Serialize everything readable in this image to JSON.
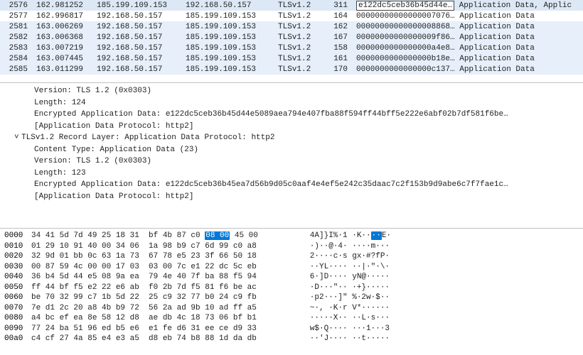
{
  "packets": [
    {
      "no": "2576",
      "time": "162.981252",
      "src": "185.199.109.153",
      "dst": "192.168.50.157",
      "proto": "TLSv1.2",
      "len": "311",
      "info_prefix": "e122dc5ceb36b45d44e…",
      "info_rest": " Application Data, Applic",
      "hl": true,
      "rowclass": "row-sel"
    },
    {
      "no": "2577",
      "time": "162.996817",
      "src": "192.168.50.157",
      "dst": "185.199.109.153",
      "proto": "TLSv1.2",
      "len": "164",
      "info": "00000000000000007076… Application Data",
      "rowclass": "row-plain"
    },
    {
      "no": "2581",
      "time": "163.006269",
      "src": "192.168.50.157",
      "dst": "185.199.109.153",
      "proto": "TLSv1.2",
      "len": "162",
      "info": "00000000000000008868… Application Data",
      "rowclass": "row-sel2"
    },
    {
      "no": "2582",
      "time": "163.006368",
      "src": "192.168.50.157",
      "dst": "185.199.109.153",
      "proto": "TLSv1.2",
      "len": "167",
      "info": "00000000000000009f86… Application Data",
      "rowclass": "row-sel2"
    },
    {
      "no": "2583",
      "time": "163.007219",
      "src": "192.168.50.157",
      "dst": "185.199.109.153",
      "proto": "TLSv1.2",
      "len": "158",
      "info": "0000000000000000a4e8… Application Data",
      "rowclass": "row-sel2"
    },
    {
      "no": "2584",
      "time": "163.007445",
      "src": "192.168.50.157",
      "dst": "185.199.109.153",
      "proto": "TLSv1.2",
      "len": "161",
      "info": "0000000000000000b18e… Application Data",
      "rowclass": "row-sel2"
    },
    {
      "no": "2585",
      "time": "163.011299",
      "src": "192.168.50.157",
      "dst": "185.199.109.153",
      "proto": "TLSv1.2",
      "len": "170",
      "info": "0000000000000000c137… Application Data",
      "rowclass": "row-sel2"
    }
  ],
  "details": {
    "version": "Version: TLS 1.2 (0x0303)",
    "length1": "Length: 124",
    "enc1": "Encrypted Application Data: e122dc5ceb36b45d44e5089aea794e407fba88f594ff44bff5e222e6abf02b7df581f6be…",
    "adp1": "[Application Data Protocol: http2]",
    "record": "TLSv1.2 Record Layer: Application Data Protocol: http2",
    "contenttype": "Content Type: Application Data (23)",
    "version2": "Version: TLS 1.2 (0x0303)",
    "length2": "Length: 123",
    "enc2": "Encrypted Application Data: e122dc5ceb36b45ea7d56b9d05c0aaf4e4ef5e242c35daac7c2f153b9d9abe6c7f7fae1c…",
    "adp2": "[Application Data Protocol: http2]"
  },
  "hex": [
    {
      "off": "0000",
      "b1": "34 41 5d 7d 49 25 18 31",
      "b2": "bf 4b 87 c0 ",
      "bhl": "08 00",
      "b3": " 45 00",
      "a1": "4A]}I%·1 ·K··",
      "ahl": "··",
      "a2": "E·"
    },
    {
      "off": "0010",
      "b": "01 29 10 91 40 00 34 06  1a 98 b9 c7 6d 99 c0 a8",
      "a": "·)··@·4· ····m···"
    },
    {
      "off": "0020",
      "b": "32 9d 01 bb 0c 63 1a 73  67 78 e5 23 3f 66 50 18",
      "a": "2····c·s gx·#?fP·"
    },
    {
      "off": "0030",
      "b": "00 87 59 4c 00 00 17 03  03 00 7c e1 22 dc 5c eb",
      "a": "··YL···· ··|·\"·\\·"
    },
    {
      "off": "0040",
      "b": "36 b4 5d 44 e5 08 9a ea  79 4e 40 7f ba 88 f5 94",
      "a": "6·]D···· yN@·····"
    },
    {
      "off": "0050",
      "b": "ff 44 bf f5 e2 22 e6 ab  f0 2b 7d f5 81 f6 be ac",
      "a": "·D···\"·· ·+}·····"
    },
    {
      "off": "0060",
      "b": "be 70 32 99 c7 1b 5d 22  25 c9 32 77 b0 24 c9 fb",
      "a": "·p2···]\" %·2w·$··"
    },
    {
      "off": "0070",
      "b": "7e d1 2c 20 a8 4b b9 72  56 2a ad 9b 10 ad ff a5",
      "a": "~·, ·K·r V*······"
    },
    {
      "off": "0080",
      "b": "a4 bc ef ea 8e 58 12 d8  ae db 4c 18 73 06 bf b1",
      "a": "·····X·· ··L·s···"
    },
    {
      "off": "0090",
      "b": "77 24 ba 51 96 ed b5 e6  e1 fe d6 31 ee ce d9 33",
      "a": "w$·Q···· ···1···3"
    },
    {
      "off": "00a0",
      "b": "c4 cf 27 4a 85 e4 e3 a5  d8 eb 74 b8 88 1d da db",
      "a": "··'J···· ··t·····"
    }
  ]
}
